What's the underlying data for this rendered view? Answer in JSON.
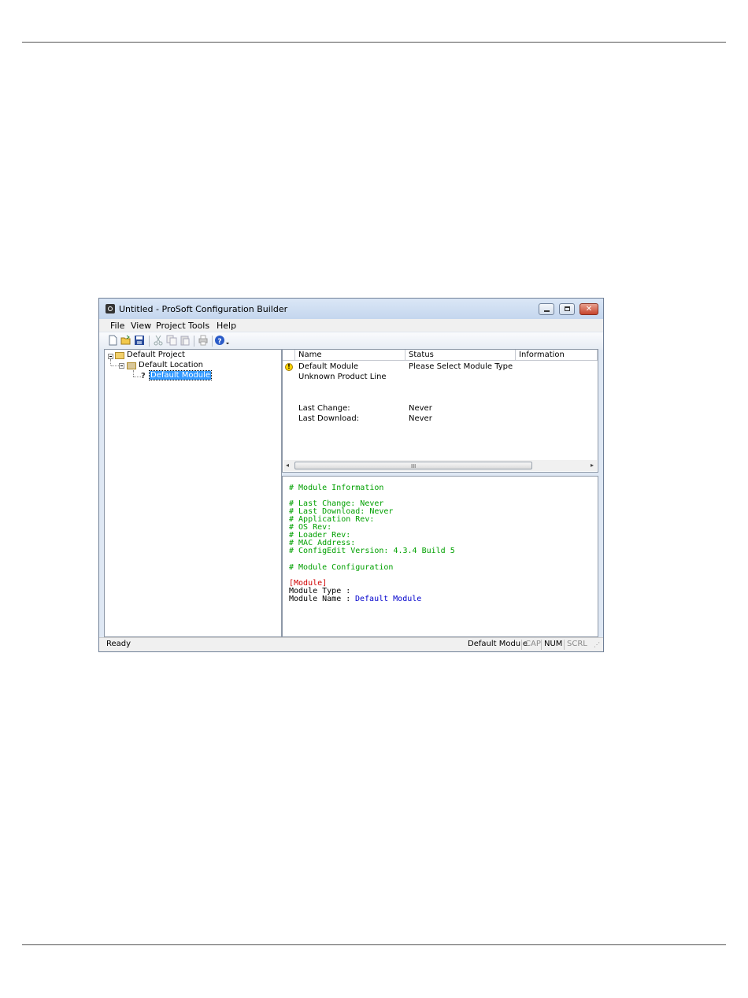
{
  "window": {
    "title": "Untitled - ProSoft Configuration Builder",
    "buttons": {
      "min": "minimize-icon",
      "max": "maximize-icon",
      "close": "✕"
    }
  },
  "menu": [
    "File",
    "View",
    "Project",
    "Tools",
    "Help"
  ],
  "toolbar_icons": [
    "new-icon",
    "open-icon",
    "save-icon",
    "cut-icon",
    "copy-icon",
    "paste-icon",
    "print-icon",
    "help-icon"
  ],
  "tree": {
    "project": "Default Project",
    "location": "Default Location",
    "module": "Default Module"
  },
  "list": {
    "columns": [
      "Name",
      "Status",
      "Information"
    ],
    "rows": [
      {
        "name": "Default Module",
        "status": "Please Select Module Type"
      },
      {
        "name": "Unknown Product Line",
        "status": ""
      },
      {
        "name": "Last Change:",
        "status": "Never"
      },
      {
        "name": "Last Download:",
        "status": "Never"
      }
    ],
    "scroll_grip": "III"
  },
  "config_text": {
    "h1": "# Module Information",
    "l1": "# Last Change: Never",
    "l2": "# Last Download: Never",
    "l3": "# Application Rev:",
    "l4": "# OS Rev:",
    "l5": "# Loader Rev:",
    "l6": "# MAC Address:",
    "l7": "# ConfigEdit Version: 4.3.4 Build 5",
    "h2": "# Module Configuration",
    "section": "[Module]",
    "type_label": "Module Type :",
    "name_label": "Module Name :",
    "name_value": "Default Module"
  },
  "status_bar": {
    "left": "Ready",
    "module": "Default Module",
    "cap": "CAP",
    "num": "NUM",
    "scrl": "SCRL"
  }
}
